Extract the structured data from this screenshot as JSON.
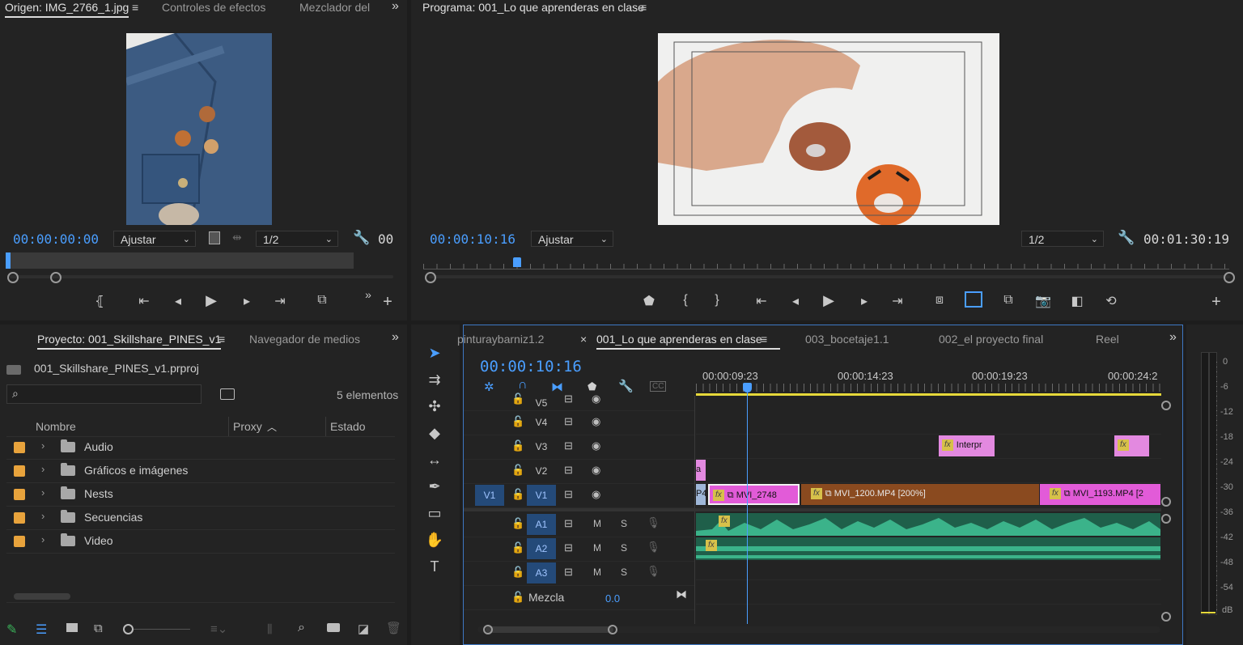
{
  "source_monitor": {
    "tabs": [
      "Origen: IMG_2766_1.jpg",
      "Controles de efectos",
      "Mezclador del"
    ],
    "timecode": "00:00:00:00",
    "zoom": "Ajustar",
    "resolution": "1/2",
    "duration": "00",
    "overflow": "»",
    "menu": "≡"
  },
  "program_monitor": {
    "title": "Programa: 001_Lo que aprenderas en clase",
    "timecode": "00:00:10:16",
    "zoom": "Ajustar",
    "resolution": "1/2",
    "duration": "00:01:30:19",
    "menu": "≡"
  },
  "project": {
    "tabs": [
      "Proyecto: 001_Skillshare_PINES_v1",
      "Navegador de medios"
    ],
    "file": "001_Skillshare_PINES_v1.prproj",
    "count": "5 elementos",
    "columns": [
      "Nombre",
      "Proxy",
      "Estado"
    ],
    "items": [
      "Audio",
      "Gráficos e imágenes",
      "Nests",
      "Secuencias",
      "Video"
    ],
    "overflow": "»",
    "menu": "≡"
  },
  "timeline": {
    "tabs": [
      "pinturaybarniz1.2",
      "001_Lo que aprenderas en clase",
      "003_bocetaje1.1",
      "002_el proyecto final",
      "Reel"
    ],
    "close": "×",
    "menu": "≡",
    "overflow": "»",
    "timecode": "00:00:10:16",
    "ruler": [
      "00:00:09:23",
      "00:00:14:23",
      "00:00:19:23",
      "00:00:24:2"
    ],
    "video_tracks": [
      "V5",
      "V4",
      "V3",
      "V2",
      "V1"
    ],
    "source_patch": "V1",
    "audio_tracks": [
      "A1",
      "A2",
      "A3"
    ],
    "mute": "M",
    "solo": "S",
    "mix_label": "Mezcla",
    "mix_value": "0.0",
    "clips": {
      "v3a": "Interpr",
      "v1a": "MVI_2748",
      "v1b": "MVI_1200.MP4 [200%]",
      "v1c": "MVI_1193.MP4 [2",
      "v1left": "P4",
      "v2left": "a"
    },
    "fx": "fx"
  },
  "meter": {
    "labels": [
      "0",
      "-6",
      "-12",
      "-18",
      "-24",
      "-30",
      "-36",
      "-42",
      "-48",
      "-54",
      "dB"
    ]
  },
  "colors": {
    "accent": "#4a9eff",
    "clip_pink": "#e25bd8",
    "clip_brown": "#8a4a1f",
    "audio_green": "#3bb38a",
    "label_orange": "#e8a33c",
    "work_area": "#e6d83a"
  }
}
